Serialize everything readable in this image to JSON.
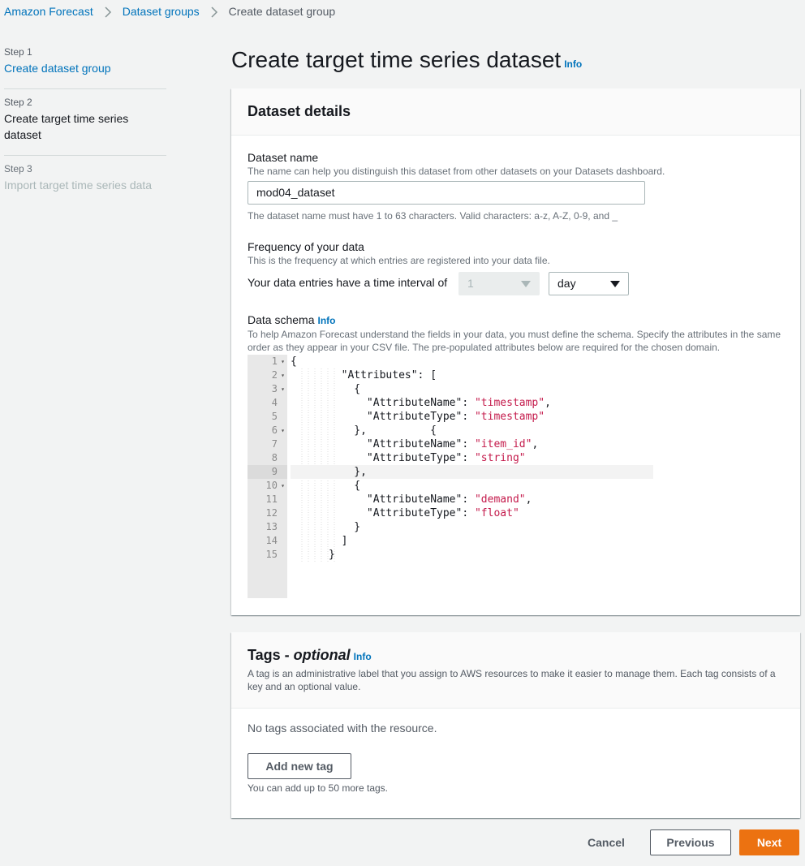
{
  "breadcrumb": {
    "items": [
      "Amazon Forecast",
      "Dataset groups"
    ],
    "current": "Create dataset group"
  },
  "steps": [
    {
      "num": "Step 1",
      "label": "Create dataset group"
    },
    {
      "num": "Step 2",
      "label": "Create target time series dataset"
    },
    {
      "num": "Step 3",
      "label": "Import target time series data"
    }
  ],
  "page": {
    "title": "Create target time series dataset",
    "info": "Info"
  },
  "details": {
    "title": "Dataset details",
    "name_label": "Dataset name",
    "name_desc": "The name can help you distinguish this dataset from other datasets on your Datasets dashboard.",
    "name_value": "mod04_dataset",
    "name_hint": "The dataset name must have 1 to 63 characters. Valid characters: a-z, A-Z, 0-9, and _",
    "freq_label": "Frequency of your data",
    "freq_desc": "This is the frequency at which entries are registered into your data file.",
    "freq_interval_label": "Your data entries have a time interval of",
    "freq_number": "1",
    "freq_unit": "day",
    "schema_label": "Data schema",
    "schema_info": "Info",
    "schema_desc": "To help Amazon Forecast understand the fields in your data, you must define the schema. Specify the attributes in the same order as they appear in your CSV file. The pre-populated attributes below are required for the chosen domain."
  },
  "editor": {
    "line_numbers": [
      "1",
      "2",
      "3",
      "4",
      "5",
      "6",
      "7",
      "8",
      "9",
      "10",
      "11",
      "12",
      "13",
      "14",
      "15"
    ],
    "active_line": 9,
    "lines": [
      "{",
      "        \"Attributes\": [",
      "          {",
      "            \"AttributeName\": \"timestamp\",",
      "            \"AttributeType\": \"timestamp\"",
      "          },          {",
      "            \"AttributeName\": \"item_id\",",
      "            \"AttributeType\": \"string\"",
      "          },",
      "          {",
      "            \"AttributeName\": \"demand\",",
      "            \"AttributeType\": \"float\"",
      "          }",
      "        ]",
      "      }"
    ]
  },
  "tags": {
    "title_prefix": "Tags - ",
    "title_optional": "optional",
    "info": "Info",
    "desc": "A tag is an administrative label that you assign to AWS resources to make it easier to manage them. Each tag consists of a key and an optional value.",
    "empty": "No tags associated with the resource.",
    "add_button": "Add new tag",
    "limit": "You can add up to 50 more tags."
  },
  "footer": {
    "cancel": "Cancel",
    "previous": "Previous",
    "next": "Next"
  },
  "colors": {
    "link": "#0073bb",
    "primary": "#ec7211",
    "string": "#c41a4b"
  }
}
